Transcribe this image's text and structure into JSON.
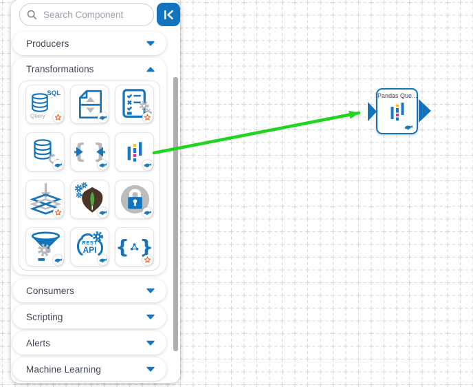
{
  "search": {
    "placeholder": "Search Component"
  },
  "toolbar": {
    "collapse_button": "collapse-panel-left"
  },
  "sidebar": {
    "sections": [
      {
        "label": "Producers",
        "state": "collapsed"
      },
      {
        "label": "Transformations",
        "state": "expanded"
      },
      {
        "label": "Consumers",
        "state": "collapsed"
      },
      {
        "label": "Scripting",
        "state": "collapsed"
      },
      {
        "label": "Alerts",
        "state": "collapsed"
      },
      {
        "label": "Machine Learning",
        "state": "collapsed"
      }
    ],
    "tiles": [
      {
        "icon": "sql-query-database",
        "badge": "spark-star",
        "texts": {
          "sql": "SQL",
          "query": "Query"
        }
      },
      {
        "icon": "file-sort",
        "badge": "whale"
      },
      {
        "icon": "checklist-gears",
        "badge": "spark-star"
      },
      {
        "icon": "database-refresh",
        "badge": "whale"
      },
      {
        "icon": "braces-merge",
        "badge": "whale"
      },
      {
        "icon": "pandas",
        "badge": "whale"
      },
      {
        "icon": "layers-insert",
        "badge": "spark-star"
      },
      {
        "icon": "mongodb-gears",
        "badge": "whale"
      },
      {
        "icon": "lock",
        "badge": "whale"
      },
      {
        "icon": "funnel-gear",
        "badge": "whale"
      },
      {
        "icon": "rest-api-cloud",
        "badge": "whale",
        "texts": {
          "rest": "REST",
          "api": "API"
        }
      },
      {
        "icon": "braces-network",
        "badge": "spark-star"
      }
    ]
  },
  "canvas": {
    "node": {
      "title": "Pandas Que...",
      "icon": "pandas",
      "badge": "whale"
    },
    "annotation": "green-drag-arrow"
  },
  "colors": {
    "accent": "#1373bd",
    "green_arrow": "#22d422",
    "star_orange": "#e8611c",
    "grid_line": "#d7d7d7",
    "gray_icon": "#b9b9b9"
  }
}
